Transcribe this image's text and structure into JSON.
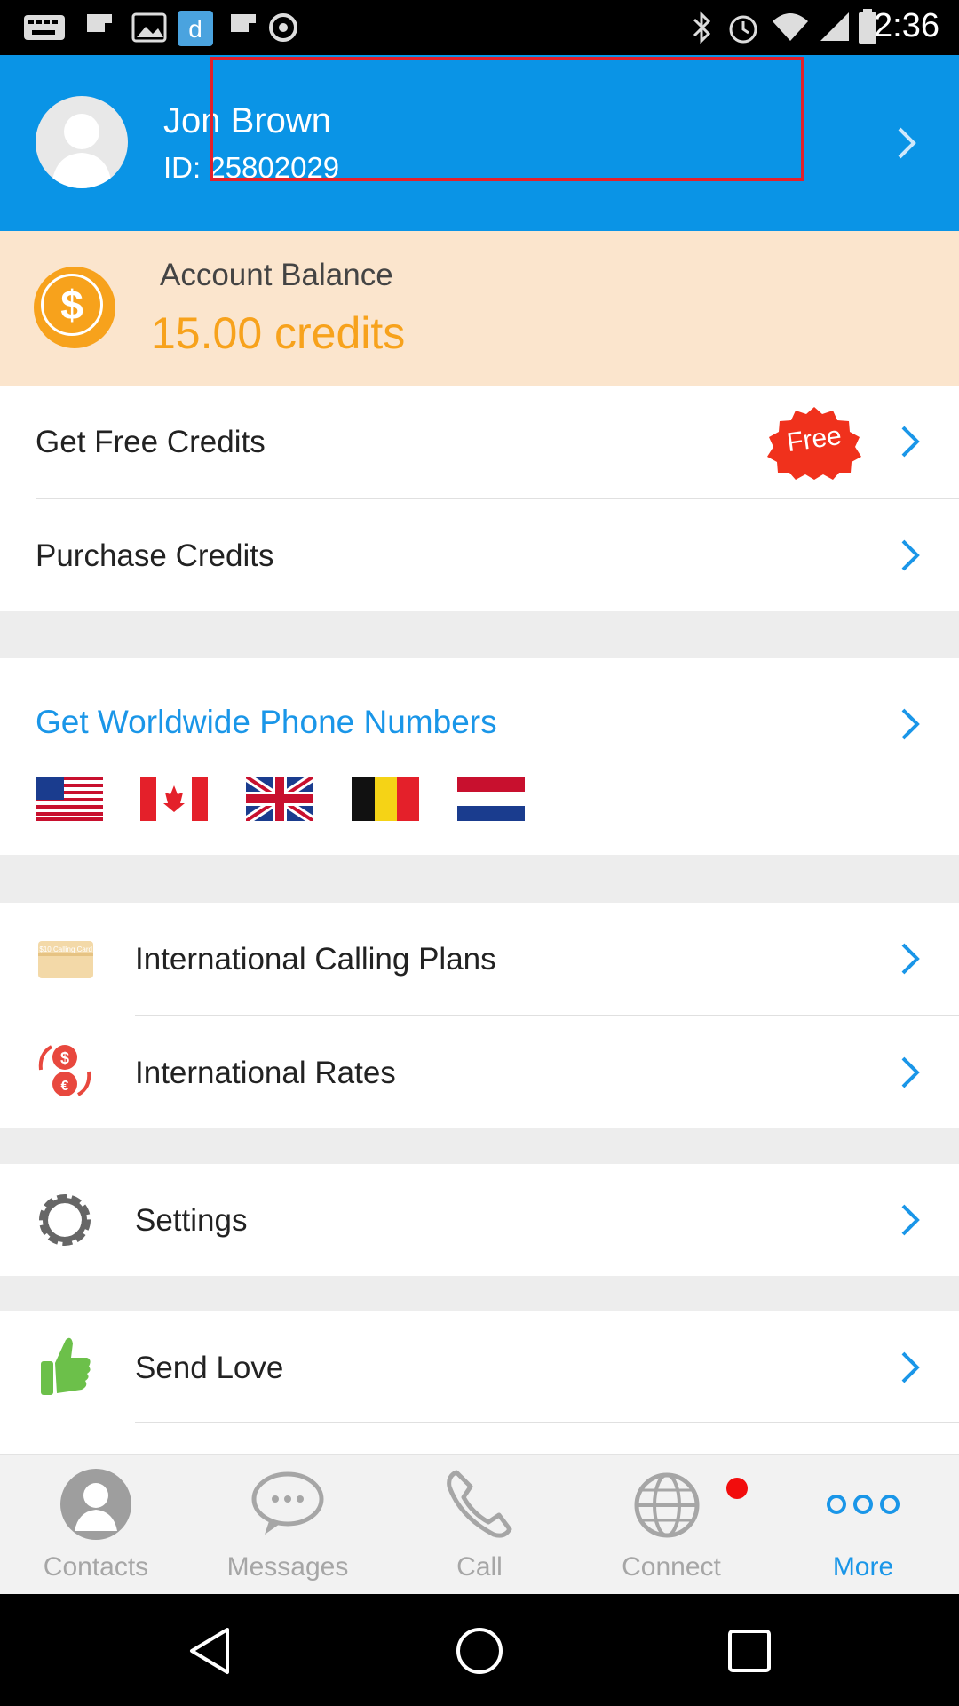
{
  "status_bar": {
    "time": "2:36",
    "icons": [
      "keyboard-icon",
      "flipboard-icon",
      "image-icon",
      "app-d-icon",
      "flipboard-icon",
      "settings-icon",
      "bluetooth-icon",
      "alarm-icon",
      "wifi-icon",
      "signal-icon",
      "battery-icon"
    ]
  },
  "profile": {
    "name": "Jon Brown",
    "id": "ID: 25802029"
  },
  "balance": {
    "label": "Account Balance",
    "value": "15.00 credits"
  },
  "credits": {
    "free_label": "Get Free Credits",
    "free_badge": "Free",
    "purchase_label": "Purchase Credits"
  },
  "worldwide": {
    "label": "Get Worldwide Phone Numbers",
    "flags": [
      "us-flag",
      "canada-flag",
      "uk-flag",
      "belgium-flag",
      "netherlands-flag"
    ]
  },
  "plans": {
    "calling_plans": "International Calling Plans",
    "calling_card_text": "$10 Calling Card",
    "rates": "International Rates"
  },
  "settings": {
    "label": "Settings"
  },
  "love": {
    "label": "Send Love"
  },
  "nav": {
    "items": [
      {
        "label": "Contacts"
      },
      {
        "label": "Messages"
      },
      {
        "label": "Call"
      },
      {
        "label": "Connect"
      },
      {
        "label": "More"
      }
    ],
    "active": "More"
  },
  "colors": {
    "brand_blue": "#0a94e6",
    "accent_orange": "#f7a21c",
    "balance_bg": "#fbe5cd",
    "highlight_red": "#e4202a"
  }
}
